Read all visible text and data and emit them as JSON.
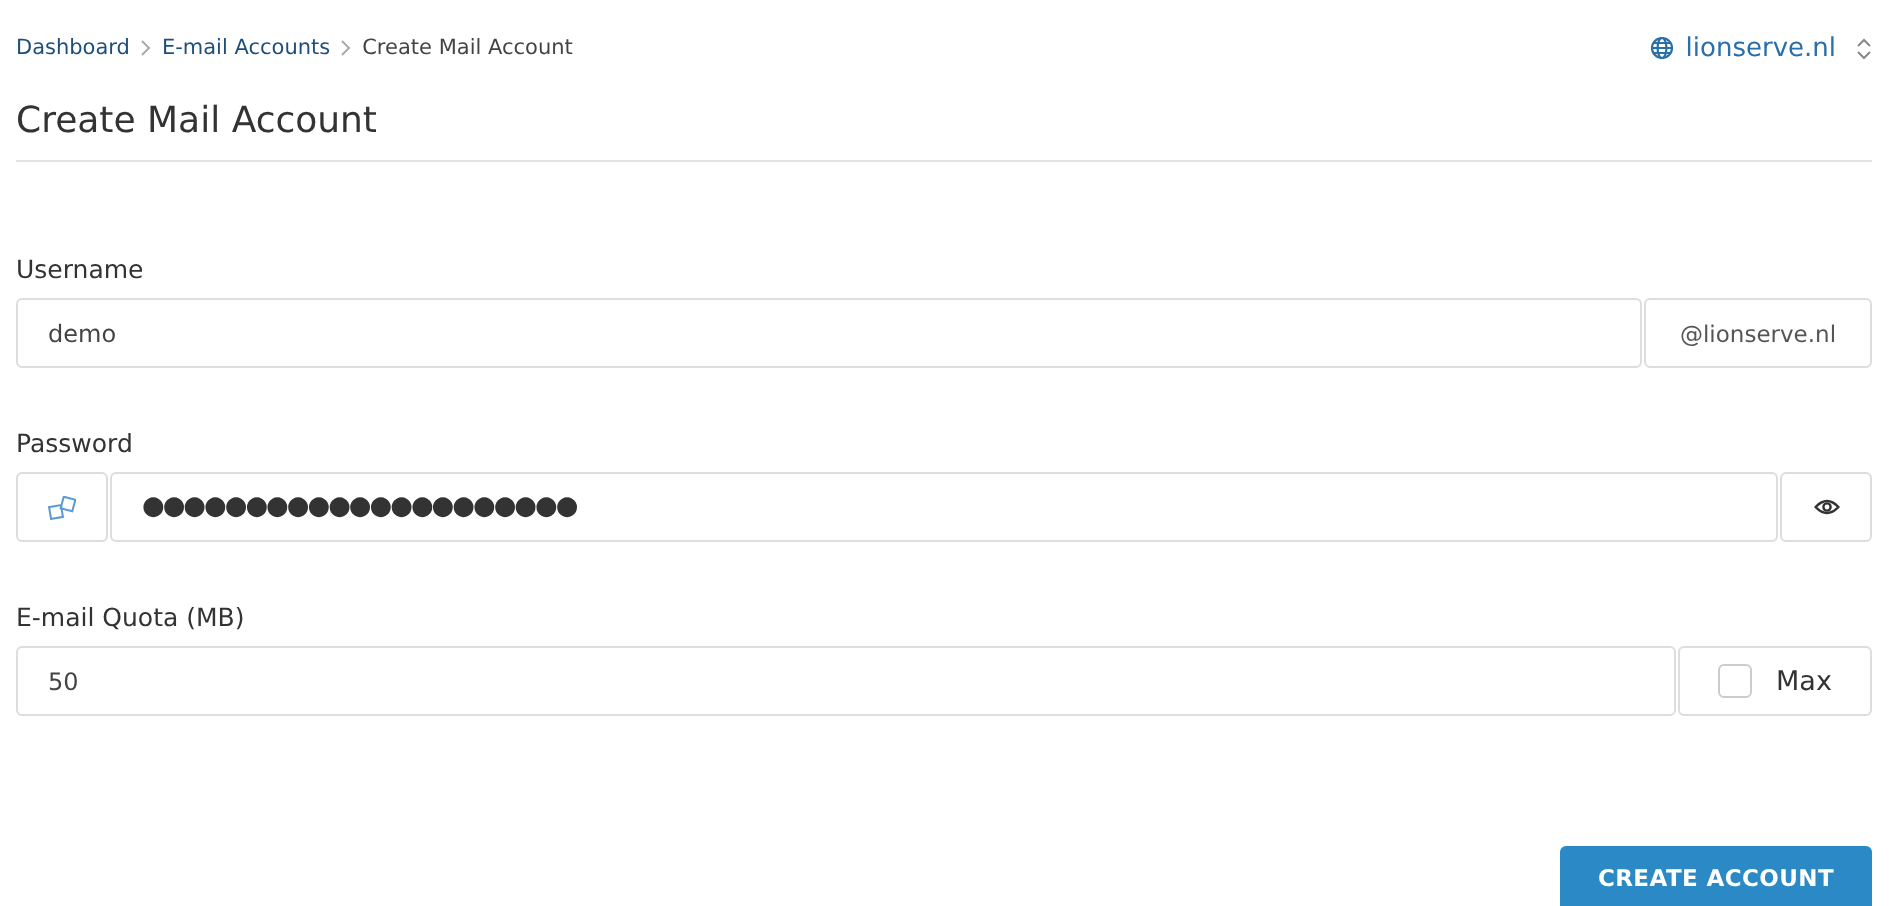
{
  "breadcrumb": [
    {
      "label": "Dashboard",
      "link": true
    },
    {
      "label": "E-mail Accounts",
      "link": true
    },
    {
      "label": "Create Mail Account",
      "link": false
    }
  ],
  "domain_selector": {
    "label": "lionserve.nl"
  },
  "title": "Create Mail Account",
  "username": {
    "label": "Username",
    "value": "demo",
    "suffix": "@lionserve.nl"
  },
  "password": {
    "label": "Password",
    "value": "●●●●●●●●●●●●●●●●●●●●●"
  },
  "quota": {
    "label": "E-mail Quota (MB)",
    "value": "50",
    "max_label": "Max",
    "max_checked": false
  },
  "submit": "CREATE ACCOUNT"
}
